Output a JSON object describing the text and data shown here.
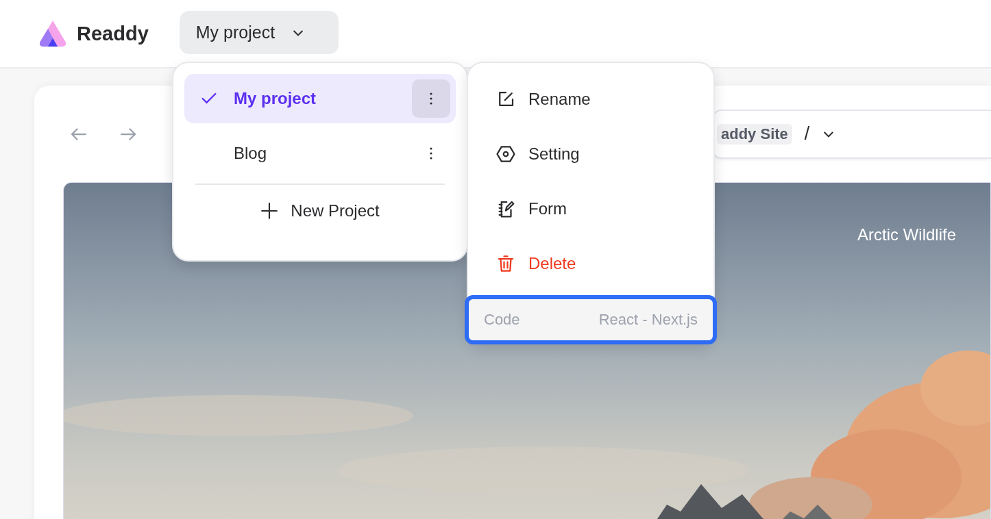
{
  "header": {
    "brand": "Readdy",
    "project_button": "My project"
  },
  "browser_bar": {
    "site_badge": "addy Site",
    "separator": "/"
  },
  "preview": {
    "caption": "Arctic Wildlife"
  },
  "project_menu": {
    "items": [
      {
        "label": "My project",
        "selected": true
      },
      {
        "label": "Blog",
        "selected": false
      }
    ],
    "new_button": "New Project"
  },
  "actions_menu": {
    "items": [
      {
        "label": "Rename",
        "kind": "rename"
      },
      {
        "label": "Setting",
        "kind": "setting"
      },
      {
        "label": "Form",
        "kind": "form"
      },
      {
        "label": "Delete",
        "kind": "delete"
      }
    ],
    "code_row": {
      "label": "Code",
      "value": "React - Next.js",
      "highlighted": true
    }
  }
}
